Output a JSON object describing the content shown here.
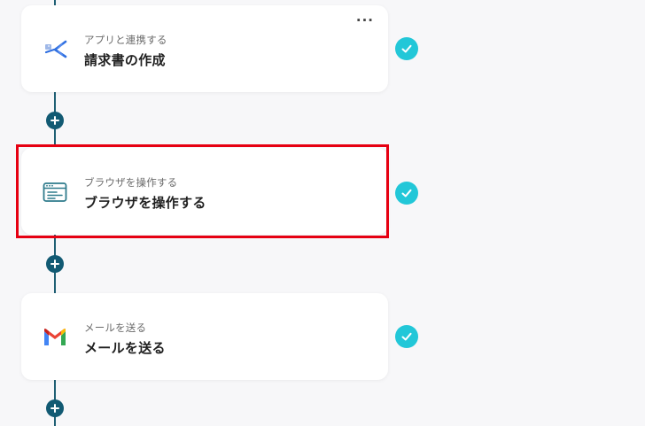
{
  "steps": [
    {
      "subtitle": "アプリと連携する",
      "title": "請求書の作成",
      "icon": "invoice-app-icon",
      "more": "···",
      "status": "completed"
    },
    {
      "subtitle": "ブラウザを操作する",
      "title": "ブラウザを操作する",
      "icon": "browser-window-icon",
      "status": "completed",
      "highlighted": true
    },
    {
      "subtitle": "メールを送る",
      "title": "メールを送る",
      "icon": "gmail-icon",
      "status": "completed"
    }
  ],
  "colors": {
    "check": "#22c7d8",
    "connector": "#1f5f74",
    "plus_button": "#125a73",
    "highlight": "#e60012"
  }
}
